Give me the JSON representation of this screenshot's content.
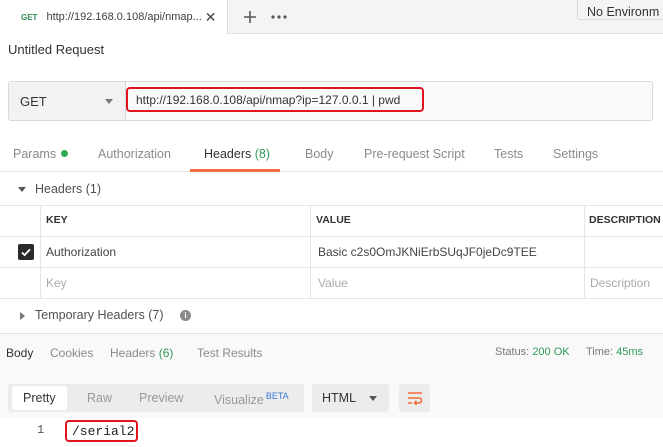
{
  "tabbar": {
    "method": "GET",
    "tab_title": "http://192.168.0.108/api/nmap...",
    "env_label": "No Environm"
  },
  "request": {
    "title": "Untitled Request",
    "method": "GET",
    "url": "http://192.168.0.108/api/nmap?ip=127.0.0.1 | pwd"
  },
  "subtabs": {
    "params": "Params",
    "authorization": "Authorization",
    "headers": "Headers",
    "headers_count": "(8)",
    "body": "Body",
    "prerequest": "Pre-request Script",
    "tests": "Tests",
    "settings": "Settings"
  },
  "headers_section": {
    "title": "Headers",
    "count": "(1)",
    "columns": [
      "KEY",
      "VALUE",
      "DESCRIPTION"
    ],
    "rows": [
      {
        "key": "Authorization",
        "value": "Basic c2s0OmJKNiErbSUqJF0jeDc9TEE",
        "checked": true
      }
    ],
    "placeholders": {
      "key": "Key",
      "value": "Value",
      "description": "Description"
    },
    "temp_title": "Temporary Headers",
    "temp_count": "(7)",
    "info_glyph": "i"
  },
  "response": {
    "tabs": {
      "body": "Body",
      "cookies": "Cookies",
      "headers": "Headers",
      "headers_count": "(6)",
      "test_results": "Test Results"
    },
    "status_label": "Status:",
    "status_value": "200 OK",
    "time_label": "Time:",
    "time_value": "45ms",
    "view_modes": {
      "pretty": "Pretty",
      "raw": "Raw",
      "preview": "Preview",
      "visualize": "Visualize",
      "beta": "BETA"
    },
    "format": "HTML",
    "line_number": "1",
    "body_line": "/serial2"
  },
  "colors": {
    "accent_orange": "#f26b3a",
    "status_green": "#2e9a58",
    "highlight_red": "#e0141e"
  }
}
